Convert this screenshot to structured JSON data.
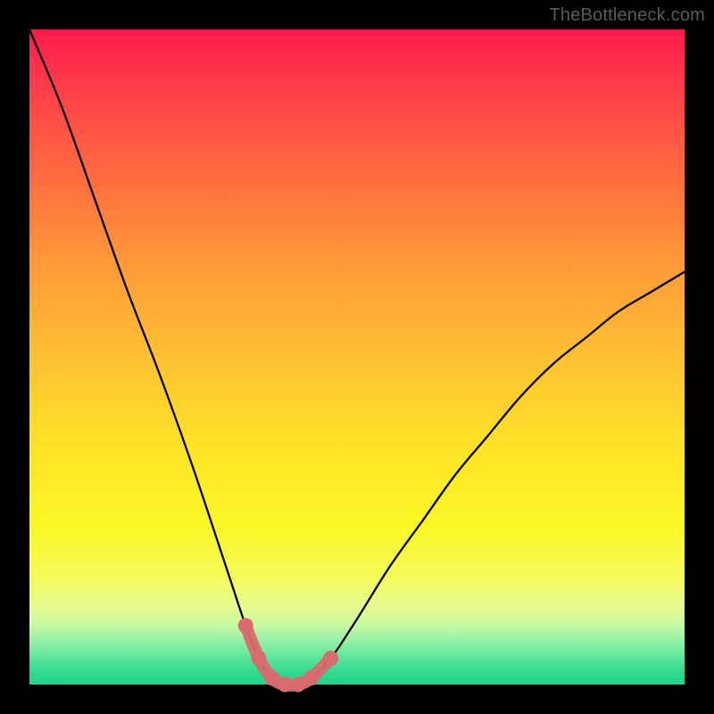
{
  "watermark": "TheBottleneck.com",
  "colors": {
    "frame": "#000000",
    "curve": "#000000",
    "marker": "#d96a6e",
    "gradient_top": "#ff1a4d",
    "gradient_bottom": "#23d487"
  },
  "chart_data": {
    "type": "line",
    "title": "",
    "xlabel": "",
    "ylabel": "",
    "xlim": [
      0,
      100
    ],
    "ylim": [
      0,
      100
    ],
    "grid": false,
    "legend": false,
    "series": [
      {
        "name": "bottleneck-curve",
        "x": [
          0,
          5,
          10,
          15,
          20,
          25,
          30,
          33,
          35,
          37,
          39,
          41,
          43,
          46,
          50,
          55,
          60,
          65,
          70,
          75,
          80,
          85,
          90,
          95,
          100
        ],
        "y": [
          100,
          88,
          74,
          60,
          47,
          33,
          18,
          9,
          4,
          1,
          0,
          0,
          1,
          4,
          10,
          18,
          25,
          32,
          38,
          44,
          49,
          53,
          57,
          60,
          63
        ]
      }
    ],
    "annotations": [
      {
        "name": "trough-markers",
        "x": [
          33,
          35,
          37,
          39,
          41,
          43,
          46
        ],
        "y": [
          9,
          4,
          1,
          0,
          0,
          1,
          4
        ]
      }
    ]
  }
}
